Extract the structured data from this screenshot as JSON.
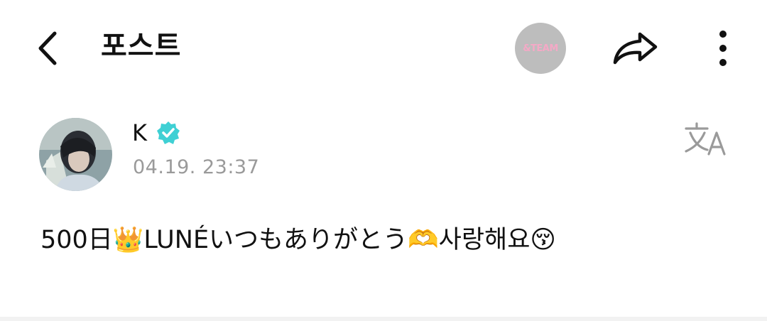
{
  "header": {
    "title": "포스트",
    "community_logo_text": "&TEAM",
    "icons": {
      "back": "chevron-left-icon",
      "share": "share-arrow-icon",
      "more": "more-vertical-icon"
    }
  },
  "post": {
    "author_name": "K",
    "timestamp": "04.19. 23:37",
    "body_text": "500日👑LUNÉいつもありがとう🫶사랑해요😚",
    "icons": {
      "verified": "verified-badge-icon",
      "translate": "translate-icon"
    }
  },
  "colors": {
    "verified_badge": "#3fd0d4",
    "timestamp": "#9a9a9a",
    "community_avatar_bg": "#bdbdbd",
    "community_logo": "#f4a9c6"
  }
}
